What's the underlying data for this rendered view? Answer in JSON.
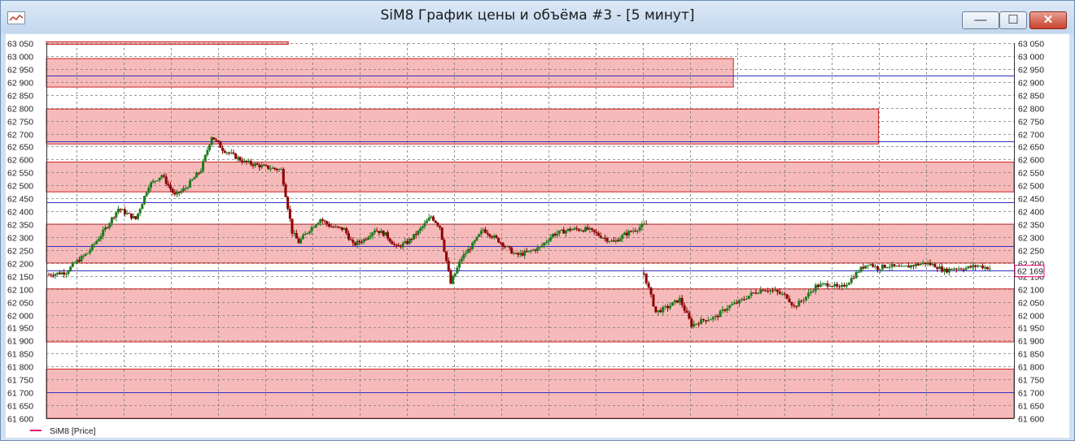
{
  "window": {
    "title": "SiM8 График цены и объёма #3 - [5 минут]",
    "minimize_label": "—",
    "maximize_label": "☐",
    "close_label": "✕"
  },
  "chart_data": {
    "type": "candlestick",
    "title": "SiM8 График цены и объёма #3 - [5 минут]",
    "ylim": [
      61600,
      63050
    ],
    "y_ticks": [
      "63 050",
      "63 000",
      "62 950",
      "62 900",
      "62 850",
      "62 800",
      "62 750",
      "62 700",
      "62 650",
      "62 600",
      "62 550",
      "62 500",
      "62 450",
      "62 400",
      "62 350",
      "62 300",
      "62 250",
      "62 200",
      "62 150",
      "62 100",
      "62 050",
      "62 000",
      "61 950",
      "61 900",
      "61 850",
      "61 800",
      "61 750",
      "61 700",
      "61 650",
      "61 600"
    ],
    "grid": true,
    "last_price_label": "62 169",
    "legend": {
      "placement": "bottom-left",
      "label": "SiM8 [Price]",
      "color": "#e0006e"
    },
    "colors": {
      "up": "#1f7a1f",
      "down": "#8b0000",
      "zone_fill": "#f4a3a3",
      "zone_edge": "#cc2222",
      "level_line": "#3030c0"
    },
    "zones": [
      {
        "low": 63045,
        "high": 63080,
        "end_fraction": 0.25
      },
      {
        "low": 62880,
        "high": 62990,
        "end_fraction": 0.71
      },
      {
        "low": 62660,
        "high": 62795,
        "end_fraction": 0.86
      },
      {
        "low": 62475,
        "high": 62590,
        "end_fraction": 1.0
      },
      {
        "low": 62200,
        "high": 62350,
        "end_fraction": 1.0
      },
      {
        "low": 61895,
        "high": 62100,
        "end_fraction": 1.0
      },
      {
        "low": 61600,
        "high": 61790,
        "end_fraction": 1.0
      }
    ],
    "levels": [
      62925,
      62670,
      62435,
      62265,
      62170,
      61700
    ],
    "segments": [
      {
        "start_fraction": 0.0,
        "end_fraction": 0.62,
        "anchors": [
          [
            0,
            62155
          ],
          [
            8,
            62165
          ],
          [
            12,
            62200
          ],
          [
            18,
            62240
          ],
          [
            25,
            62320
          ],
          [
            32,
            62410
          ],
          [
            40,
            62370
          ],
          [
            46,
            62500
          ],
          [
            52,
            62540
          ],
          [
            58,
            62460
          ],
          [
            63,
            62490
          ],
          [
            70,
            62560
          ],
          [
            75,
            62690
          ],
          [
            80,
            62640
          ],
          [
            90,
            62590
          ],
          [
            100,
            62570
          ],
          [
            107,
            62560
          ],
          [
            112,
            62320
          ],
          [
            115,
            62280
          ],
          [
            120,
            62330
          ],
          [
            125,
            62370
          ],
          [
            130,
            62340
          ],
          [
            136,
            62330
          ],
          [
            140,
            62270
          ],
          [
            145,
            62290
          ],
          [
            150,
            62330
          ],
          [
            155,
            62310
          ],
          [
            160,
            62260
          ],
          [
            165,
            62280
          ],
          [
            170,
            62320
          ],
          [
            176,
            62380
          ],
          [
            180,
            62340
          ],
          [
            185,
            62120
          ],
          [
            190,
            62220
          ],
          [
            195,
            62270
          ],
          [
            200,
            62330
          ],
          [
            208,
            62280
          ],
          [
            215,
            62230
          ],
          [
            220,
            62240
          ],
          [
            226,
            62260
          ],
          [
            232,
            62310
          ],
          [
            240,
            62330
          ],
          [
            248,
            62330
          ],
          [
            255,
            62300
          ],
          [
            260,
            62280
          ],
          [
            265,
            62310
          ],
          [
            270,
            62330
          ],
          [
            275,
            62350
          ]
        ]
      },
      {
        "start_fraction": 0.615,
        "end_fraction": 0.975,
        "anchors": [
          [
            0,
            62160
          ],
          [
            5,
            62010
          ],
          [
            10,
            62030
          ],
          [
            15,
            62060
          ],
          [
            20,
            61960
          ],
          [
            25,
            61980
          ],
          [
            30,
            61990
          ],
          [
            35,
            62030
          ],
          [
            40,
            62050
          ],
          [
            45,
            62080
          ],
          [
            50,
            62100
          ],
          [
            55,
            62090
          ],
          [
            60,
            62070
          ],
          [
            63,
            62030
          ],
          [
            68,
            62070
          ],
          [
            72,
            62110
          ],
          [
            78,
            62120
          ],
          [
            82,
            62100
          ],
          [
            86,
            62130
          ],
          [
            90,
            62170
          ],
          [
            94,
            62200
          ],
          [
            98,
            62180
          ],
          [
            102,
            62190
          ],
          [
            108,
            62180
          ],
          [
            112,
            62190
          ],
          [
            118,
            62200
          ],
          [
            122,
            62190
          ],
          [
            126,
            62170
          ],
          [
            130,
            62180
          ],
          [
            135,
            62180
          ],
          [
            140,
            62190
          ],
          [
            145,
            62180
          ]
        ]
      }
    ]
  }
}
